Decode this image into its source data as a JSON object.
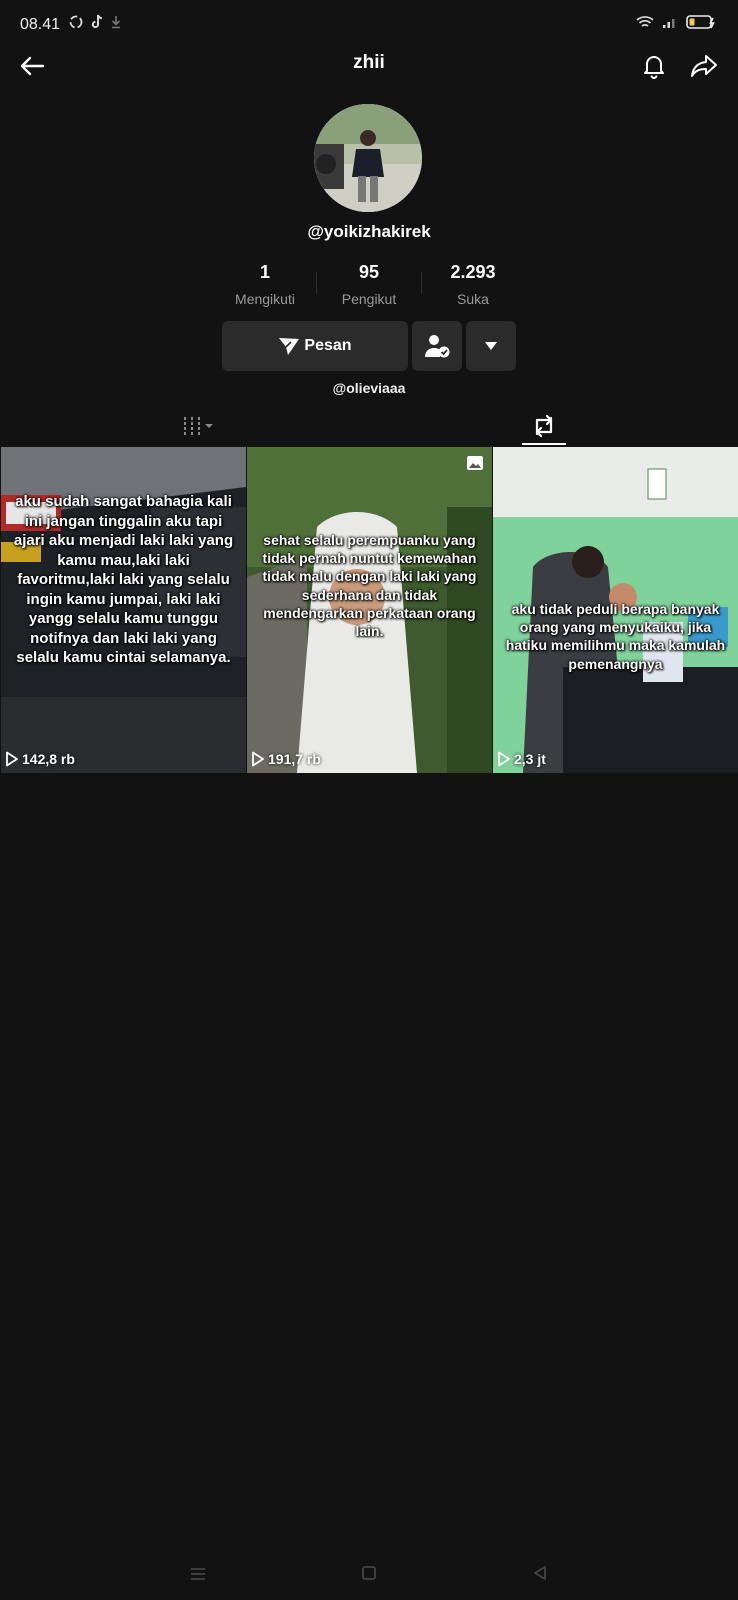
{
  "status": {
    "time": "08.41"
  },
  "header": {
    "title": "zhii"
  },
  "profile": {
    "username": "@yoikizhakirek",
    "stats": [
      {
        "value": "1",
        "label": "Mengikuti"
      },
      {
        "value": "95",
        "label": "Pengikut"
      },
      {
        "value": "2.293",
        "label": "Suka"
      }
    ],
    "message_label": "Pesan",
    "linked_account": "@olieviaaa"
  },
  "videos": [
    {
      "caption": "aku sudah sangat bahagia kali ini jangan tinggalin aku tapi ajari aku menjadi laki laki yang kamu mau,laki laki favoritmu,laki laki yang selalu ingin kamu jumpai, laki laki yangg selalu kamu tunggu notifnya dan laki laki yang selalu kamu cintai selamanya.",
      "views": "142,8 rb"
    },
    {
      "caption": "sehat selalu perempuanku yang tidak pernah nuntut kemewahan tidak malu dengan laki laki yang sederhana dan tidak mendengarkan perkataan orang lain.",
      "views": "191,7 rb"
    },
    {
      "caption": "aku tidak peduli berapa banyak orang yang menyukaiku, jika hatiku memilihmu maka kamulah pemenangnya",
      "views": "2,3 jt"
    }
  ],
  "colors": {
    "background": "#121212",
    "button": "#2b2b2b",
    "muted_text": "#9a9a9a"
  }
}
